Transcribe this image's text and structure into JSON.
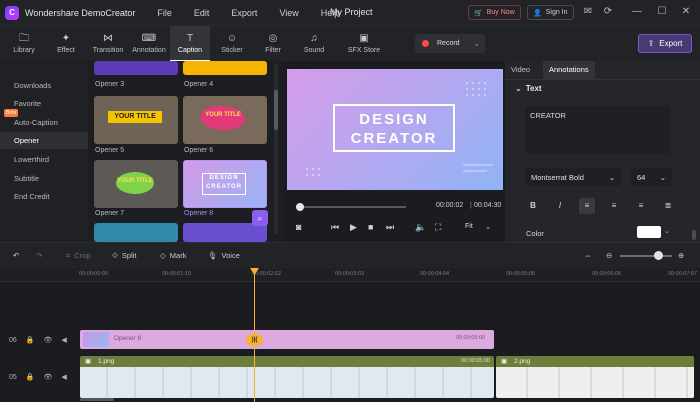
{
  "app": {
    "name": "Wondershare DemoCreator",
    "menus": [
      "File",
      "Edit",
      "Export",
      "View",
      "Help"
    ],
    "project": "My Project",
    "buy_now": "Buy Now",
    "sign_in": "Sign In"
  },
  "toolbar": {
    "tools": [
      "Library",
      "Effect",
      "Transition",
      "Annotation",
      "Caption",
      "Sticker",
      "Filter",
      "Sound",
      "SFX Store"
    ],
    "active_tool": "Caption",
    "record_label": "Record",
    "export_label": "Export"
  },
  "categories": {
    "items": [
      "Downloads",
      "Favorite",
      "Auto-Caption",
      "Opener",
      "Lowerthird",
      "Subtitle",
      "End Credit"
    ],
    "active": "Opener",
    "beta_badge": "Beta"
  },
  "thumbnails": {
    "labels": [
      "Opener 3",
      "Opener 4",
      "Opener 5",
      "Opener 6",
      "Opener 7",
      "Opener 8"
    ],
    "thumb_text": {
      "yellow_title": "YOUR TITLE",
      "design": "DESIGN",
      "creator": "CREATOR"
    }
  },
  "preview": {
    "title_line1": "DESIGN",
    "title_line2": "CREATOR",
    "current_time": "00:00:02",
    "total_time": "00:04:30",
    "fit_label": "Fit"
  },
  "annotations_panel": {
    "tabs": [
      "Video",
      "Annotations"
    ],
    "active_tab": "Annotations",
    "section": "Text",
    "text_value": "CREATOR",
    "font": "Montserrat Bold",
    "size": "64",
    "color_label": "Color",
    "color_value": "#ffffff"
  },
  "timeline_toolbar": {
    "crop": "Crop",
    "split": "Split",
    "mark": "Mark",
    "voice": "Voice"
  },
  "ruler": [
    "00:00:00:00",
    "00:00:01:10",
    "00:00:02:02",
    "00:00:03:03",
    "00:00:04:04",
    "00:00:05:05",
    "00:00:06:06",
    "00:00:07:07"
  ],
  "tracks": {
    "track1_num": "06",
    "track2_num": "05",
    "opener_clip": {
      "label": "Opener 8",
      "time": "00:00:05:00"
    },
    "png1": {
      "label": "1.png",
      "time": "00:00:05:00"
    },
    "png2": {
      "label": "2.png"
    }
  },
  "colors": {
    "accent": "#7857c8",
    "playhead": "#f7b233",
    "opener_clip": "#dda9df",
    "image_clip": "#6e7d3b"
  }
}
